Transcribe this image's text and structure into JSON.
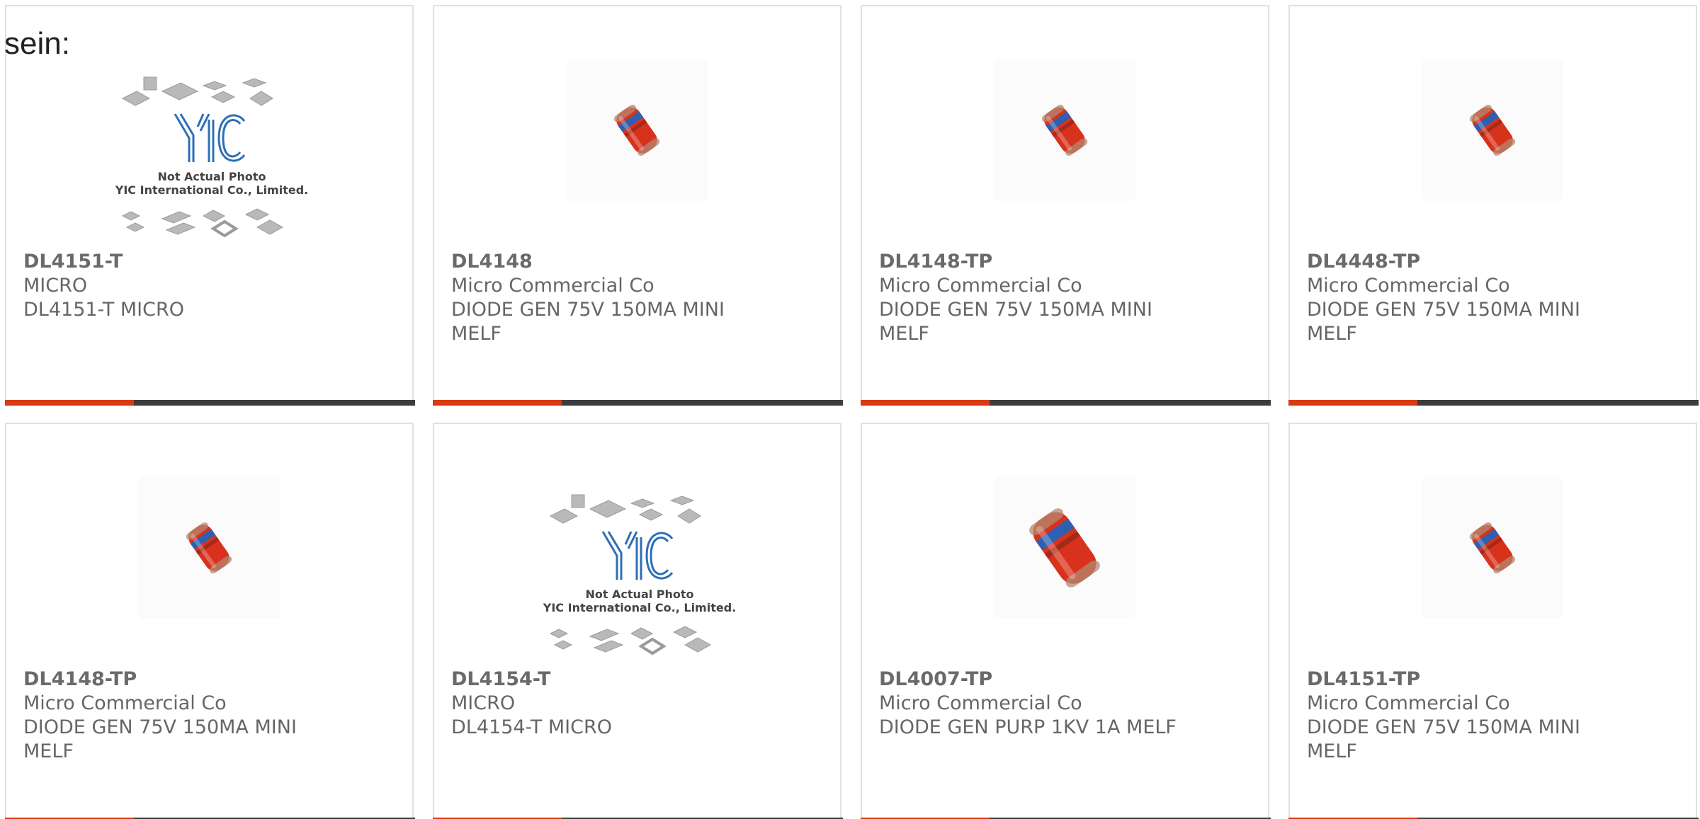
{
  "intro_text": "sein:",
  "placeholder": {
    "line1": "Not Actual Photo",
    "line2": "YIC International Co., Limited.",
    "logo_text": "YIC"
  },
  "colors": {
    "accent": "#d93a12",
    "bar": "#3d3d3d",
    "border": "#e1e1e1",
    "diode_body": "#d8321c",
    "diode_band": "#2f5fb0"
  },
  "products": [
    {
      "part": "DL4151-T",
      "maker": "MICRO",
      "desc": "DL4151-T MICRO",
      "image": "placeholder-logo"
    },
    {
      "part": "DL4148",
      "maker": "Micro Commercial Co",
      "desc": "DIODE GEN 75V 150MA MINI MELF",
      "image": "diode-photo"
    },
    {
      "part": "DL4148-TP",
      "maker": "Micro Commercial Co",
      "desc": "DIODE GEN 75V 150MA MINI MELF",
      "image": "diode-photo"
    },
    {
      "part": "DL4448-TP",
      "maker": "Micro Commercial Co",
      "desc": "DIODE GEN 75V 150MA MINI MELF",
      "image": "diode-photo"
    },
    {
      "part": "DL4148-TP",
      "maker": "Micro Commercial Co",
      "desc": "DIODE GEN 75V 150MA MINI MELF",
      "image": "diode-photo"
    },
    {
      "part": "DL4154-T",
      "maker": "MICRO",
      "desc": "DL4154-T MICRO",
      "image": "placeholder-logo"
    },
    {
      "part": "DL4007-TP",
      "maker": "Micro Commercial Co",
      "desc": "DIODE GEN PURP 1KV 1A MELF",
      "image": "diode-photo-large"
    },
    {
      "part": "DL4151-TP",
      "maker": "Micro Commercial Co",
      "desc": "DIODE GEN 75V 150MA MINI MELF",
      "image": "diode-photo"
    }
  ]
}
